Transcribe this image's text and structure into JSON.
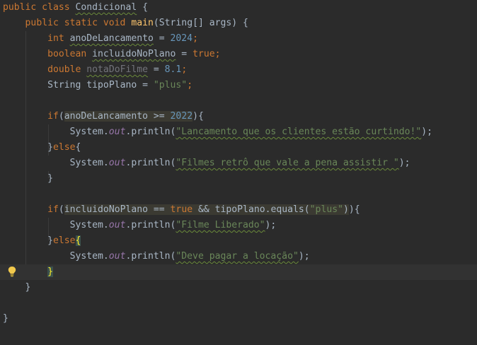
{
  "editor": {
    "language": "java",
    "theme": "Darcula",
    "hint_icon": "lightbulb-icon",
    "colors": {
      "background": "#2b2b2b",
      "keyword": "#cc7832",
      "number": "#6897bb",
      "string": "#6a8759",
      "method_declaration": "#ffc66d",
      "static_field": "#9876aa",
      "plain": "#a9b7c6",
      "unused_variable": "#72737a",
      "current_line": "#323232"
    }
  },
  "code": {
    "l1": {
      "kw": "public class",
      "class_name": "Condicional",
      "brace": " {"
    },
    "l2": {
      "kw": "public static void",
      "method": "main",
      "params": "(String[] args) {"
    },
    "l3": {
      "type": "int",
      "name": "anoDeLancamento",
      "op": " = ",
      "value": "2024",
      "end": ";"
    },
    "l4": {
      "type": "boolean",
      "name": "incluidoNoPlano",
      "op": " = ",
      "value": "true",
      "end": ";"
    },
    "l5": {
      "type": "double",
      "name": "notaDoFilme",
      "op": " = ",
      "value": "8.1",
      "end": ";"
    },
    "l6": {
      "type": "String",
      "name": "tipoPlano",
      "op": " = ",
      "value": "\"plus\"",
      "end": ";"
    },
    "l8": {
      "kw": "if",
      "open": "(",
      "cond_var": "anoDeLancamento",
      "cond_op": " >= ",
      "cond_num": "2022",
      "close": "){"
    },
    "l9": {
      "obj": "System.",
      "field": "out",
      "call": ".println(",
      "str": "\"Lancamento que os clientes estão curtindo!\"",
      "end": ");"
    },
    "l10": {
      "close_brace": "}",
      "kw": "else",
      "open_brace": "{"
    },
    "l11": {
      "obj": "System.",
      "field": "out",
      "call": ".println(",
      "str": "\"Filmes retrô que vale a pena assistir \"",
      "end": ");"
    },
    "l12": {
      "text": "}"
    },
    "l14": {
      "kw": "if",
      "open": "(",
      "var1": "incluidoNoPlano",
      "op1": " == ",
      "bool": "true",
      "op2": " && ",
      "var2": "tipoPlano",
      "call": ".equals(",
      "str": "\"plus\"",
      "close": ")){"
    },
    "l15": {
      "obj": "System.",
      "field": "out",
      "call": ".println(",
      "str": "\"Filme Liberado\"",
      "end": ");"
    },
    "l16": {
      "close_brace": "}",
      "kw": "else",
      "open_brace": "{"
    },
    "l17": {
      "obj": "System.",
      "field": "out",
      "call": ".println(",
      "str": "\"Deve pagar a locação\"",
      "end": ");"
    },
    "l18": {
      "text": "}"
    },
    "l19": {
      "text": "}"
    },
    "l21": {
      "text": "}"
    }
  }
}
